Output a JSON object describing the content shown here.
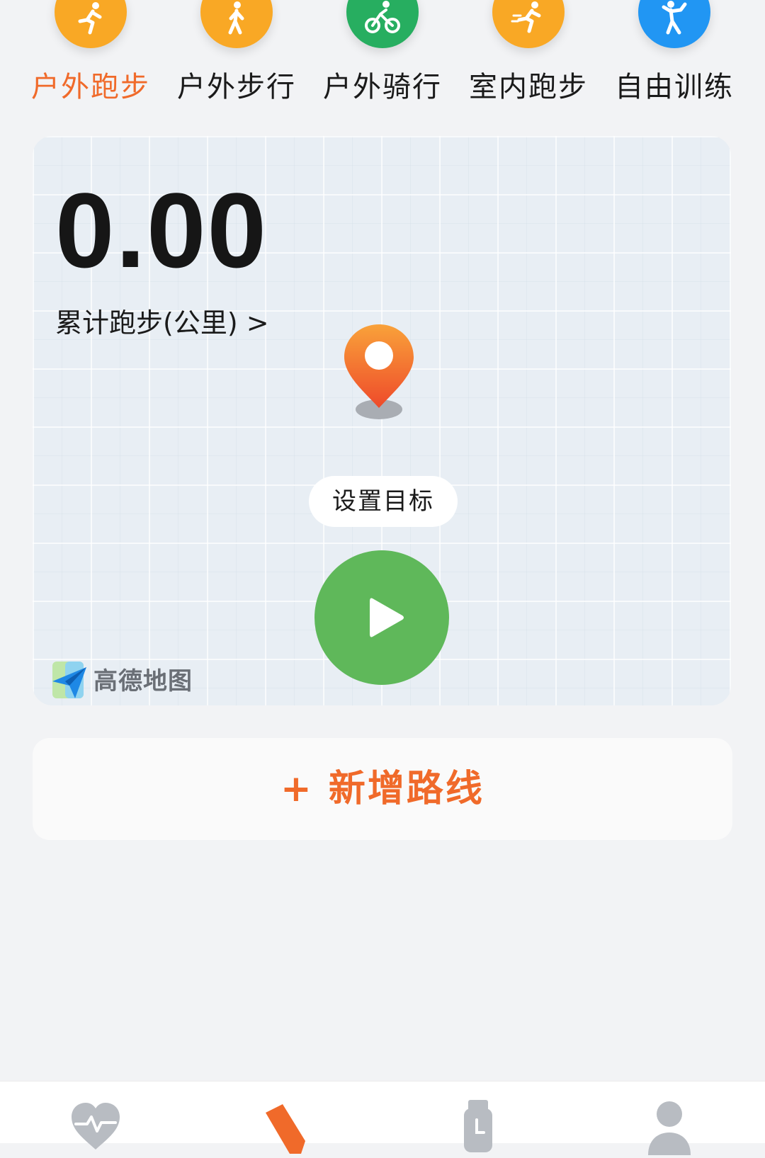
{
  "tabs": [
    {
      "label": "户外跑步",
      "icon": "running-icon",
      "color": "#f9a825",
      "active": true
    },
    {
      "label": "户外步行",
      "icon": "walking-icon",
      "color": "#f9a825",
      "active": false
    },
    {
      "label": "户外骑行",
      "icon": "cycling-icon",
      "color": "#27ae60",
      "active": false
    },
    {
      "label": "室内跑步",
      "icon": "treadmill-icon",
      "color": "#f9a825",
      "active": false
    },
    {
      "label": "自由训练",
      "icon": "free-training-icon",
      "color": "#2196f3",
      "active": false
    }
  ],
  "map": {
    "distance": "0.00",
    "distance_label": "累计跑步(公里) >",
    "goal_button": "设置目标",
    "start_icon": "play-icon",
    "logo_text": "高德地图"
  },
  "add_route": {
    "label": "+ 新增路线"
  },
  "bottom_nav": [
    {
      "icon": "heart-rate-icon"
    },
    {
      "icon": "sport-shoe-icon",
      "active": true
    },
    {
      "icon": "watch-icon"
    },
    {
      "icon": "profile-icon"
    }
  ],
  "colors": {
    "accent": "#f06a2a",
    "start_button": "#5fb85a",
    "inactive_nav": "#b8bcc2"
  }
}
